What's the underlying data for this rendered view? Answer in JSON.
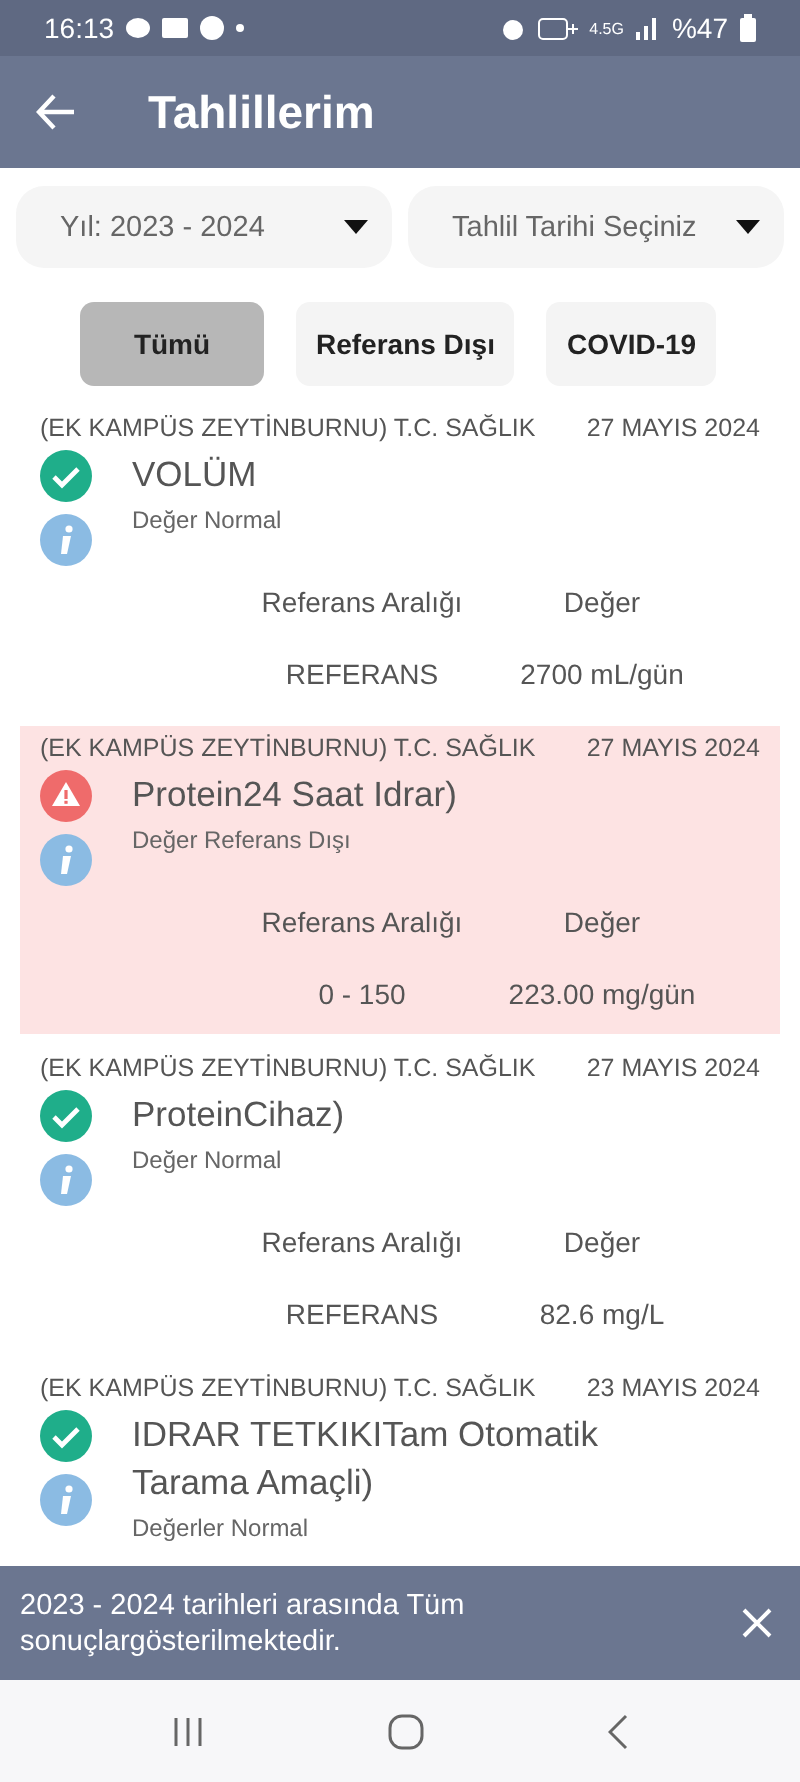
{
  "status_bar": {
    "time": "16:13",
    "network": "4.5G",
    "battery": "%47"
  },
  "app_bar": {
    "title": "Tahlillerim"
  },
  "dropdowns": [
    {
      "value": "Yıl: 2023 - 2024"
    },
    {
      "value": "Tahlil Tarihi Seçiniz"
    }
  ],
  "filters": [
    {
      "label": "Tümü",
      "selected": true
    },
    {
      "label": "Referans Dışı",
      "selected": false
    },
    {
      "label": "COVID-19",
      "selected": false
    }
  ],
  "results": [
    {
      "hospital": "(EK KAMPÜS ZEYTİNBURNU) T.C. SAĞLIK",
      "date": "27 MAYIS 2024",
      "kind": "normal",
      "test": "VOLÜM",
      "note": "Değer Normal",
      "range_label": "Referans Aralığı",
      "value_label": "Değer",
      "range": "REFERANS",
      "value": "2700 mL/gün"
    },
    {
      "hospital": "(EK KAMPÜS ZEYTİNBURNU) T.C. SAĞLIK",
      "date": "27 MAYIS 2024",
      "kind": "abnormal",
      "test": "Protein24 Saat Idrar)",
      "note": "Değer Referans Dışı",
      "range_label": "Referans Aralığı",
      "value_label": "Değer",
      "range": "0 - 150",
      "value": "223.00 mg/gün"
    },
    {
      "hospital": "(EK KAMPÜS ZEYTİNBURNU) T.C. SAĞLIK",
      "date": "27 MAYIS 2024",
      "kind": "normal",
      "test": "ProteinCihaz)",
      "note": "Değer Normal",
      "range_label": "Referans Aralığı",
      "value_label": "Değer",
      "range": "REFERANS",
      "value": "82.6 mg/L"
    },
    {
      "hospital": "(EK KAMPÜS ZEYTİNBURNU) T.C. SAĞLIK",
      "date": "23 MAYIS 2024",
      "kind": "normal",
      "test": "IDRAR TETKIKITam Otomatik Tarama Amaçli)",
      "note": "Değerler Normal"
    }
  ],
  "snackbar": {
    "message": "2023 - 2024 tarihleri arasında Tüm sonuçlargösterilmektedir."
  }
}
